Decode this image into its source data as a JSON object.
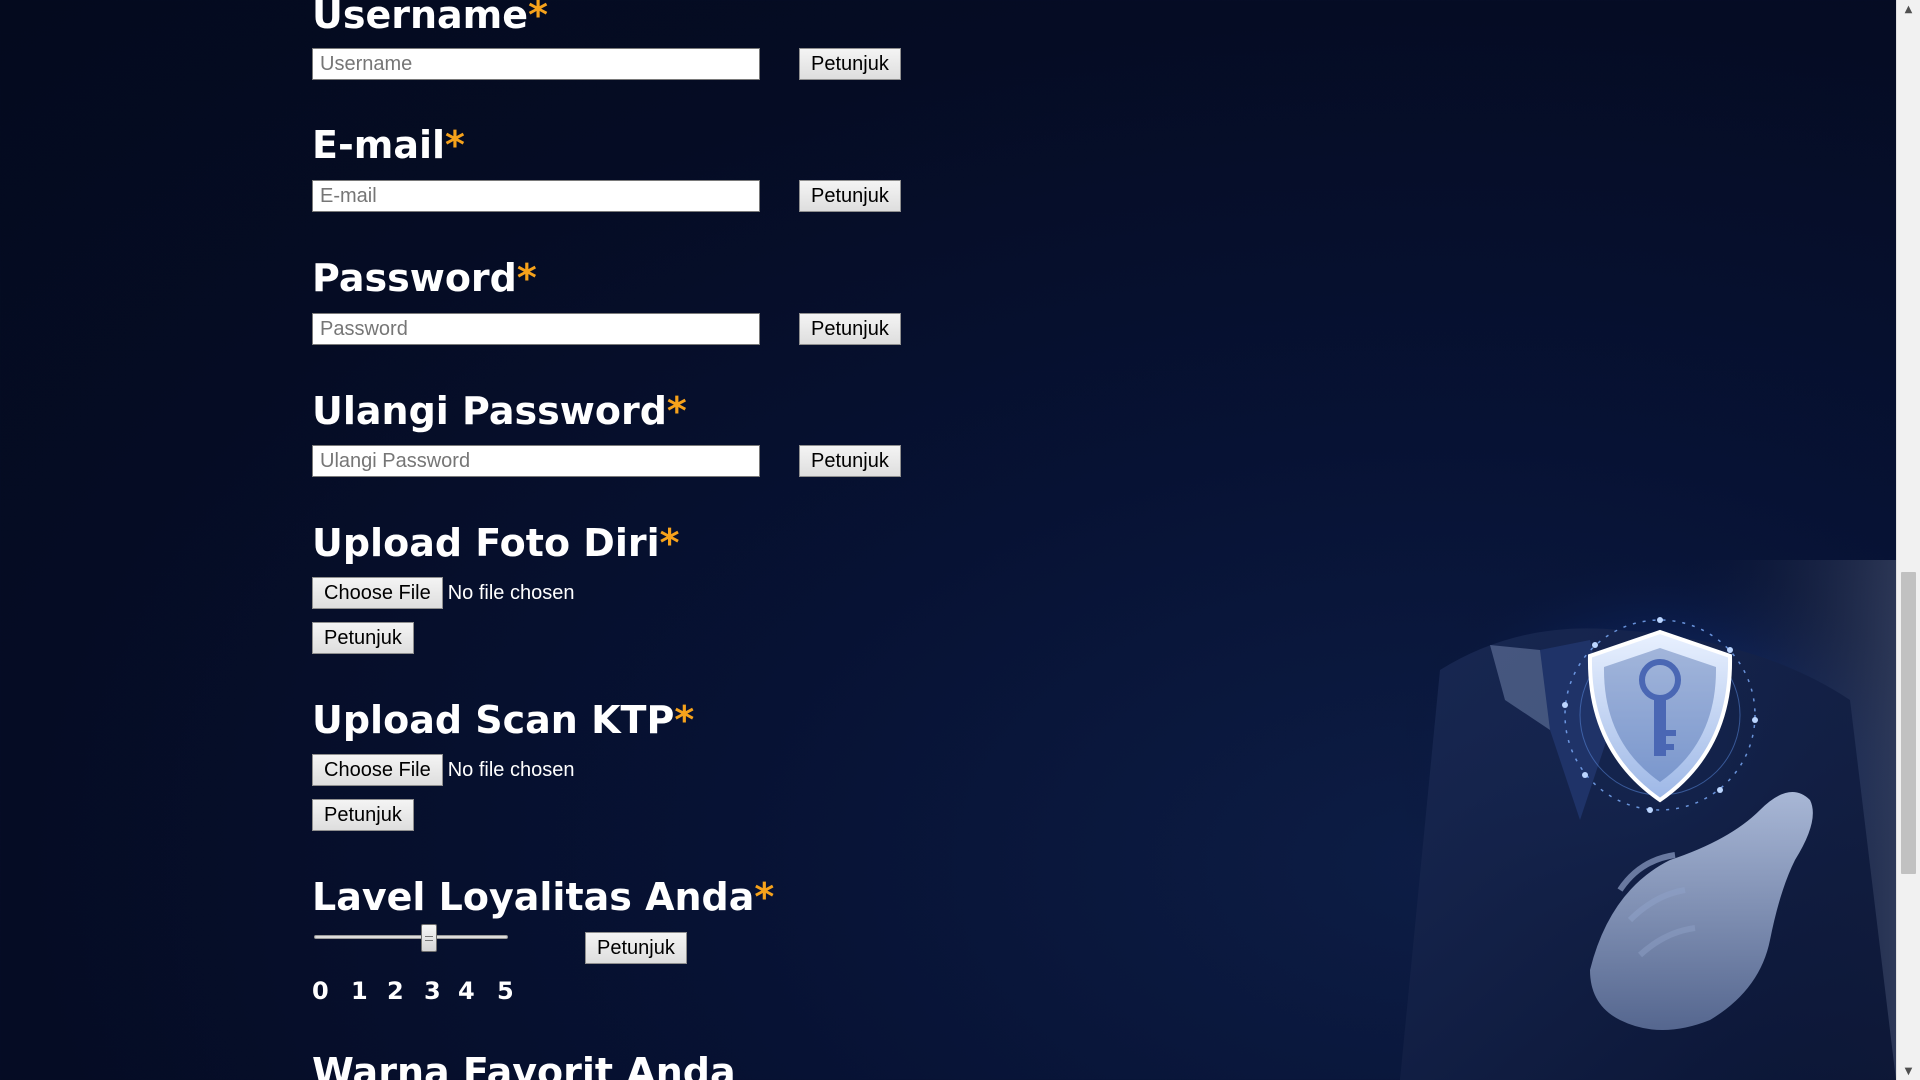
{
  "form": {
    "hint_label": "Petunjuk",
    "required_mark": "*",
    "fields": [
      {
        "label": "Username",
        "placeholder": "Username",
        "value": ""
      },
      {
        "label": "E-mail",
        "placeholder": "E-mail",
        "value": ""
      },
      {
        "label": "Password",
        "placeholder": "Password",
        "value": ""
      },
      {
        "label": "Ulangi Password",
        "placeholder": "Ulangi Password",
        "value": ""
      }
    ],
    "uploads": [
      {
        "label": "Upload Foto Diri",
        "button_label": "Choose File",
        "status": "No file chosen"
      },
      {
        "label": "Upload Scan KTP",
        "button_label": "Choose File",
        "status": "No file chosen"
      }
    ],
    "loyalty": {
      "label": "Lavel Loyalitas Anda",
      "min": 0,
      "max": 5,
      "value": 3,
      "ticks": [
        "0",
        "1",
        "2",
        "3",
        "4",
        "5"
      ]
    },
    "next_section_label": "Warna Favorit Anda"
  },
  "colors": {
    "background": "#050c24",
    "required": "#f6a21b",
    "label": "#ffffff"
  },
  "icons": {
    "hero": "security-shield-key-icon",
    "scroll_up": "triangle-up-icon",
    "scroll_down": "triangle-down-icon"
  }
}
